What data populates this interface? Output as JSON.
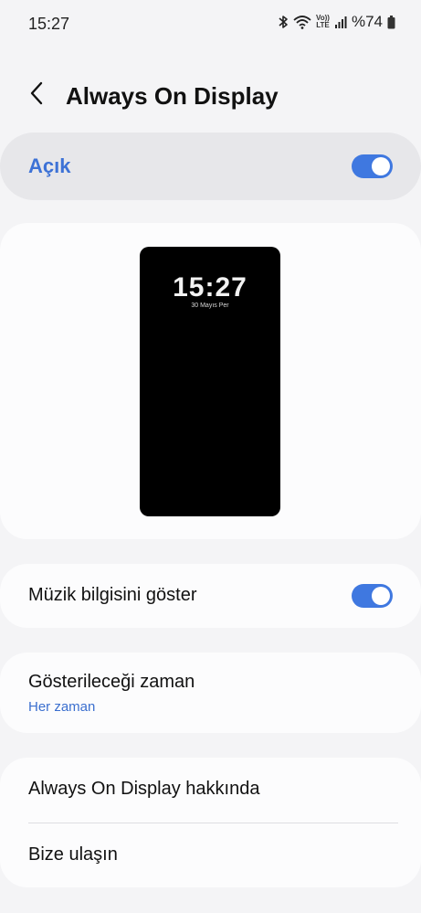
{
  "status_bar": {
    "time": "15:27",
    "volte_top": "Vo))",
    "volte_bottom": "LTE",
    "battery": "%74"
  },
  "header": {
    "title": "Always On Display"
  },
  "master_switch": {
    "label": "Açık",
    "enabled": true
  },
  "preview": {
    "clock": "15:27",
    "date": "30 Mayıs Per"
  },
  "music_info": {
    "label": "Müzik bilgisini göster",
    "enabled": true
  },
  "display_time": {
    "label": "Gösterileceği zaman",
    "value": "Her zaman"
  },
  "about": {
    "label": "Always On Display hakkında"
  },
  "contact": {
    "label": "Bize ulaşın"
  },
  "colors": {
    "accent": "#3f78e0",
    "master_label": "#3d72d6",
    "background": "#f4f4f6",
    "card": "#fcfcfd"
  },
  "icons": [
    "back-arrow-icon",
    "bluetooth-icon",
    "wifi-icon",
    "volte-icon",
    "signal-icon",
    "battery-icon"
  ]
}
